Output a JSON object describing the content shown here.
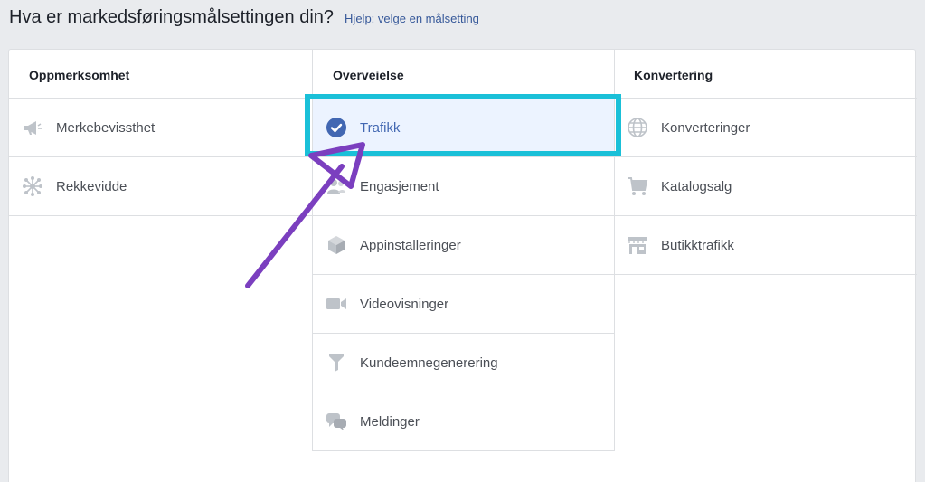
{
  "header": {
    "title": "Hva er markedsføringsmålsettingen din?",
    "help_link": "Hjelp: velge en målsetting"
  },
  "columns": [
    {
      "title": "Oppmerksomhet",
      "items": [
        {
          "label": "Merkebevissthet",
          "icon": "megaphone-icon"
        },
        {
          "label": "Rekkevidde",
          "icon": "reach-icon"
        }
      ]
    },
    {
      "title": "Overveielse",
      "items": [
        {
          "label": "Trafikk",
          "icon": "check-circle-icon",
          "selected": true
        },
        {
          "label": "Engasjement",
          "icon": "people-icon"
        },
        {
          "label": "Appinstalleringer",
          "icon": "box-icon"
        },
        {
          "label": "Videovisninger",
          "icon": "video-camera-icon"
        },
        {
          "label": "Kundeemnegenerering",
          "icon": "funnel-icon"
        },
        {
          "label": "Meldinger",
          "icon": "chat-bubbles-icon"
        }
      ]
    },
    {
      "title": "Konvertering",
      "items": [
        {
          "label": "Konverteringer",
          "icon": "globe-icon"
        },
        {
          "label": "Katalogsalg",
          "icon": "cart-icon"
        },
        {
          "label": "Butikktrafikk",
          "icon": "store-icon"
        }
      ]
    }
  ],
  "colors": {
    "selected_bg": "#ecf3ff",
    "selected_text": "#4267b2",
    "highlight_box": "#1ac0d8",
    "annotation_arrow": "#7b3fbf",
    "icon_gray": "#bec3c9"
  }
}
